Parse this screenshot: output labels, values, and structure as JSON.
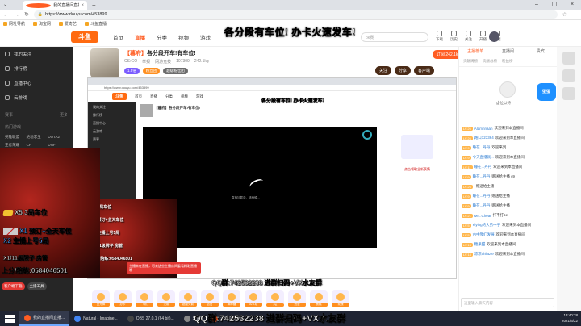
{
  "browser": {
    "tab_title": "我的直播间直播_CS:GO直播_斗鱼",
    "url": "https://www.douyu.com/453899",
    "bookmarks": [
      "网址导航",
      "淘宝网",
      "爱奇艺",
      "斗鱼直播"
    ]
  },
  "site_nav": {
    "logo": "斗鱼",
    "menu": [
      "首页",
      "直播",
      "分类",
      "视频",
      "游戏"
    ],
    "active_menu": "直播",
    "search_placeholder": "pk赛",
    "icons": [
      "下载",
      "历史",
      "关注",
      "开播",
      "消息"
    ]
  },
  "banner_text": "各分段有车位! 办卡火速发车!",
  "sidebar": {
    "items": [
      "我的关注",
      "排行榜",
      "直播中心",
      "云游戏"
    ],
    "section_title": "赛事",
    "section_more": "更多",
    "grid_head": "热门游戏",
    "grid": [
      "英雄联盟",
      "绝地求生",
      "DOTA2",
      "王者荣耀",
      "CF",
      "DNF"
    ],
    "buttons": [
      "客户端下载",
      "主播工具"
    ]
  },
  "promo": {
    "line1": "X5 3局车位",
    "line2": "X1 预订+全天车位",
    "line3": "X2 主播上号5局",
    "line4": "X1/11级牌子 房管",
    "line5": "上分/陪练:0584046501"
  },
  "room": {
    "title_tag": "【暮府】",
    "title": "各分段开车!有车位!",
    "category": "CS:GO",
    "meta": [
      "举报",
      "网游竞技",
      "107309",
      "242.1kg"
    ],
    "badges": [
      "1.5倍",
      "粉丝团",
      "超级粉丝团"
    ],
    "actions": [
      "关注",
      "分享",
      "客户端"
    ],
    "follow_count": "订阅 242.1kg"
  },
  "video_nested": {
    "addr": "https://www.douyu.com/453899",
    "menu": [
      "首页",
      "直播",
      "分类",
      "视频",
      "游戏"
    ],
    "logo": "斗鱼",
    "banner": "各分段有车位! 办卡火速发车!",
    "room_title": "【暮府】各分段开车!有车位!",
    "sidebar": [
      "我的关注",
      "排行榜",
      "直播中心",
      "云游戏",
      "赛事"
    ],
    "player_msg": "直播加载中，请稍候…",
    "chat_link": "点击领取全新表情",
    "promo_lines": [
      "X5 3局车位",
      "X1 预订+全天车位",
      "X2 主播上号5局",
      "X1/11级牌子 房管",
      "上分/陪练:0584046501"
    ],
    "warning": "主播未在直播，可来这些主播房间看看精彩直播哦"
  },
  "captions": {
    "qq_small": "QQ群:742532238 进群扫码+VX水友群",
    "qq_large": "QQ群:742532238 进群扫码+VX水友群"
  },
  "gifts": [
    "荧光棒",
    "办卡",
    "飞机",
    "火箭",
    "超级火箭",
    "告白",
    "棒棒糖",
    "么么哒",
    "PK",
    "浪漫",
    "蛋糕",
    "玫瑰"
  ],
  "right_panel": {
    "tabs": [
      "主播榜单",
      "直播间",
      "贵宾"
    ],
    "active_tab": "主播榜单",
    "subtabs": [
      "贡献周榜",
      "贡献总榜",
      "粉丝榜"
    ],
    "rank_name": "虚位以待",
    "mascot": "蛋蛋",
    "chat": [
      {
        "lv": "LV.26",
        "nick": "Alamnnaan",
        "text": "欢迎来到本直播间"
      },
      {
        "lv": "LV.26",
        "nick": "路口123364",
        "text": "欢迎来到本直播间"
      },
      {
        "lv": "LV.9",
        "nick": "睡在...丹丹",
        "text": "欢迎来到"
      },
      {
        "lv": "LV.9",
        "nick": "今天直播就...",
        "text": "欢迎来到本直播间"
      },
      {
        "lv": "LV.11",
        "nick": "睡在...丹丹",
        "text": "欢迎来到本直播间"
      },
      {
        "lv": "LV.9",
        "nick": "睡在...丹丹",
        "text": "赠送给主播 c9"
      },
      {
        "lv": "LV.26",
        "nick": "",
        "text": "赠送给主播"
      },
      {
        "lv": "LV.9",
        "nick": "睡在...丹丹",
        "text": "赠送给主播"
      },
      {
        "lv": "LV.9",
        "nick": "睡在...丹丹",
        "text": "赠送给主播"
      },
      {
        "lv": "LV.21",
        "nick": "Mr...Cheat",
        "text": "打不打5e"
      },
      {
        "lv": "LV.5",
        "nick": "Flying的大弟中子",
        "text": "欢迎来到本直播间"
      },
      {
        "lv": "LV.5",
        "nick": "古中我们发展",
        "text": "欢迎来到本直播间"
      },
      {
        "lv": "LV.13",
        "nick": "糖果甜",
        "text": "欢迎来到本直播间"
      },
      {
        "lv": "LV.14",
        "nick": "凉凉chilazle",
        "text": "欢迎来到本直播间"
      }
    ],
    "input_placeholder": "这里输入聊天内容"
  },
  "taskbar": {
    "items": [
      "我的直播间直播...",
      "Natural - Imagine...",
      "OBS 27.0.1 (64 bit)...",
      "Shell",
      "斗鱼直播伴侣"
    ],
    "active": "我的直播间直播...",
    "time": "13:40:28",
    "date": "2021/6/22"
  }
}
